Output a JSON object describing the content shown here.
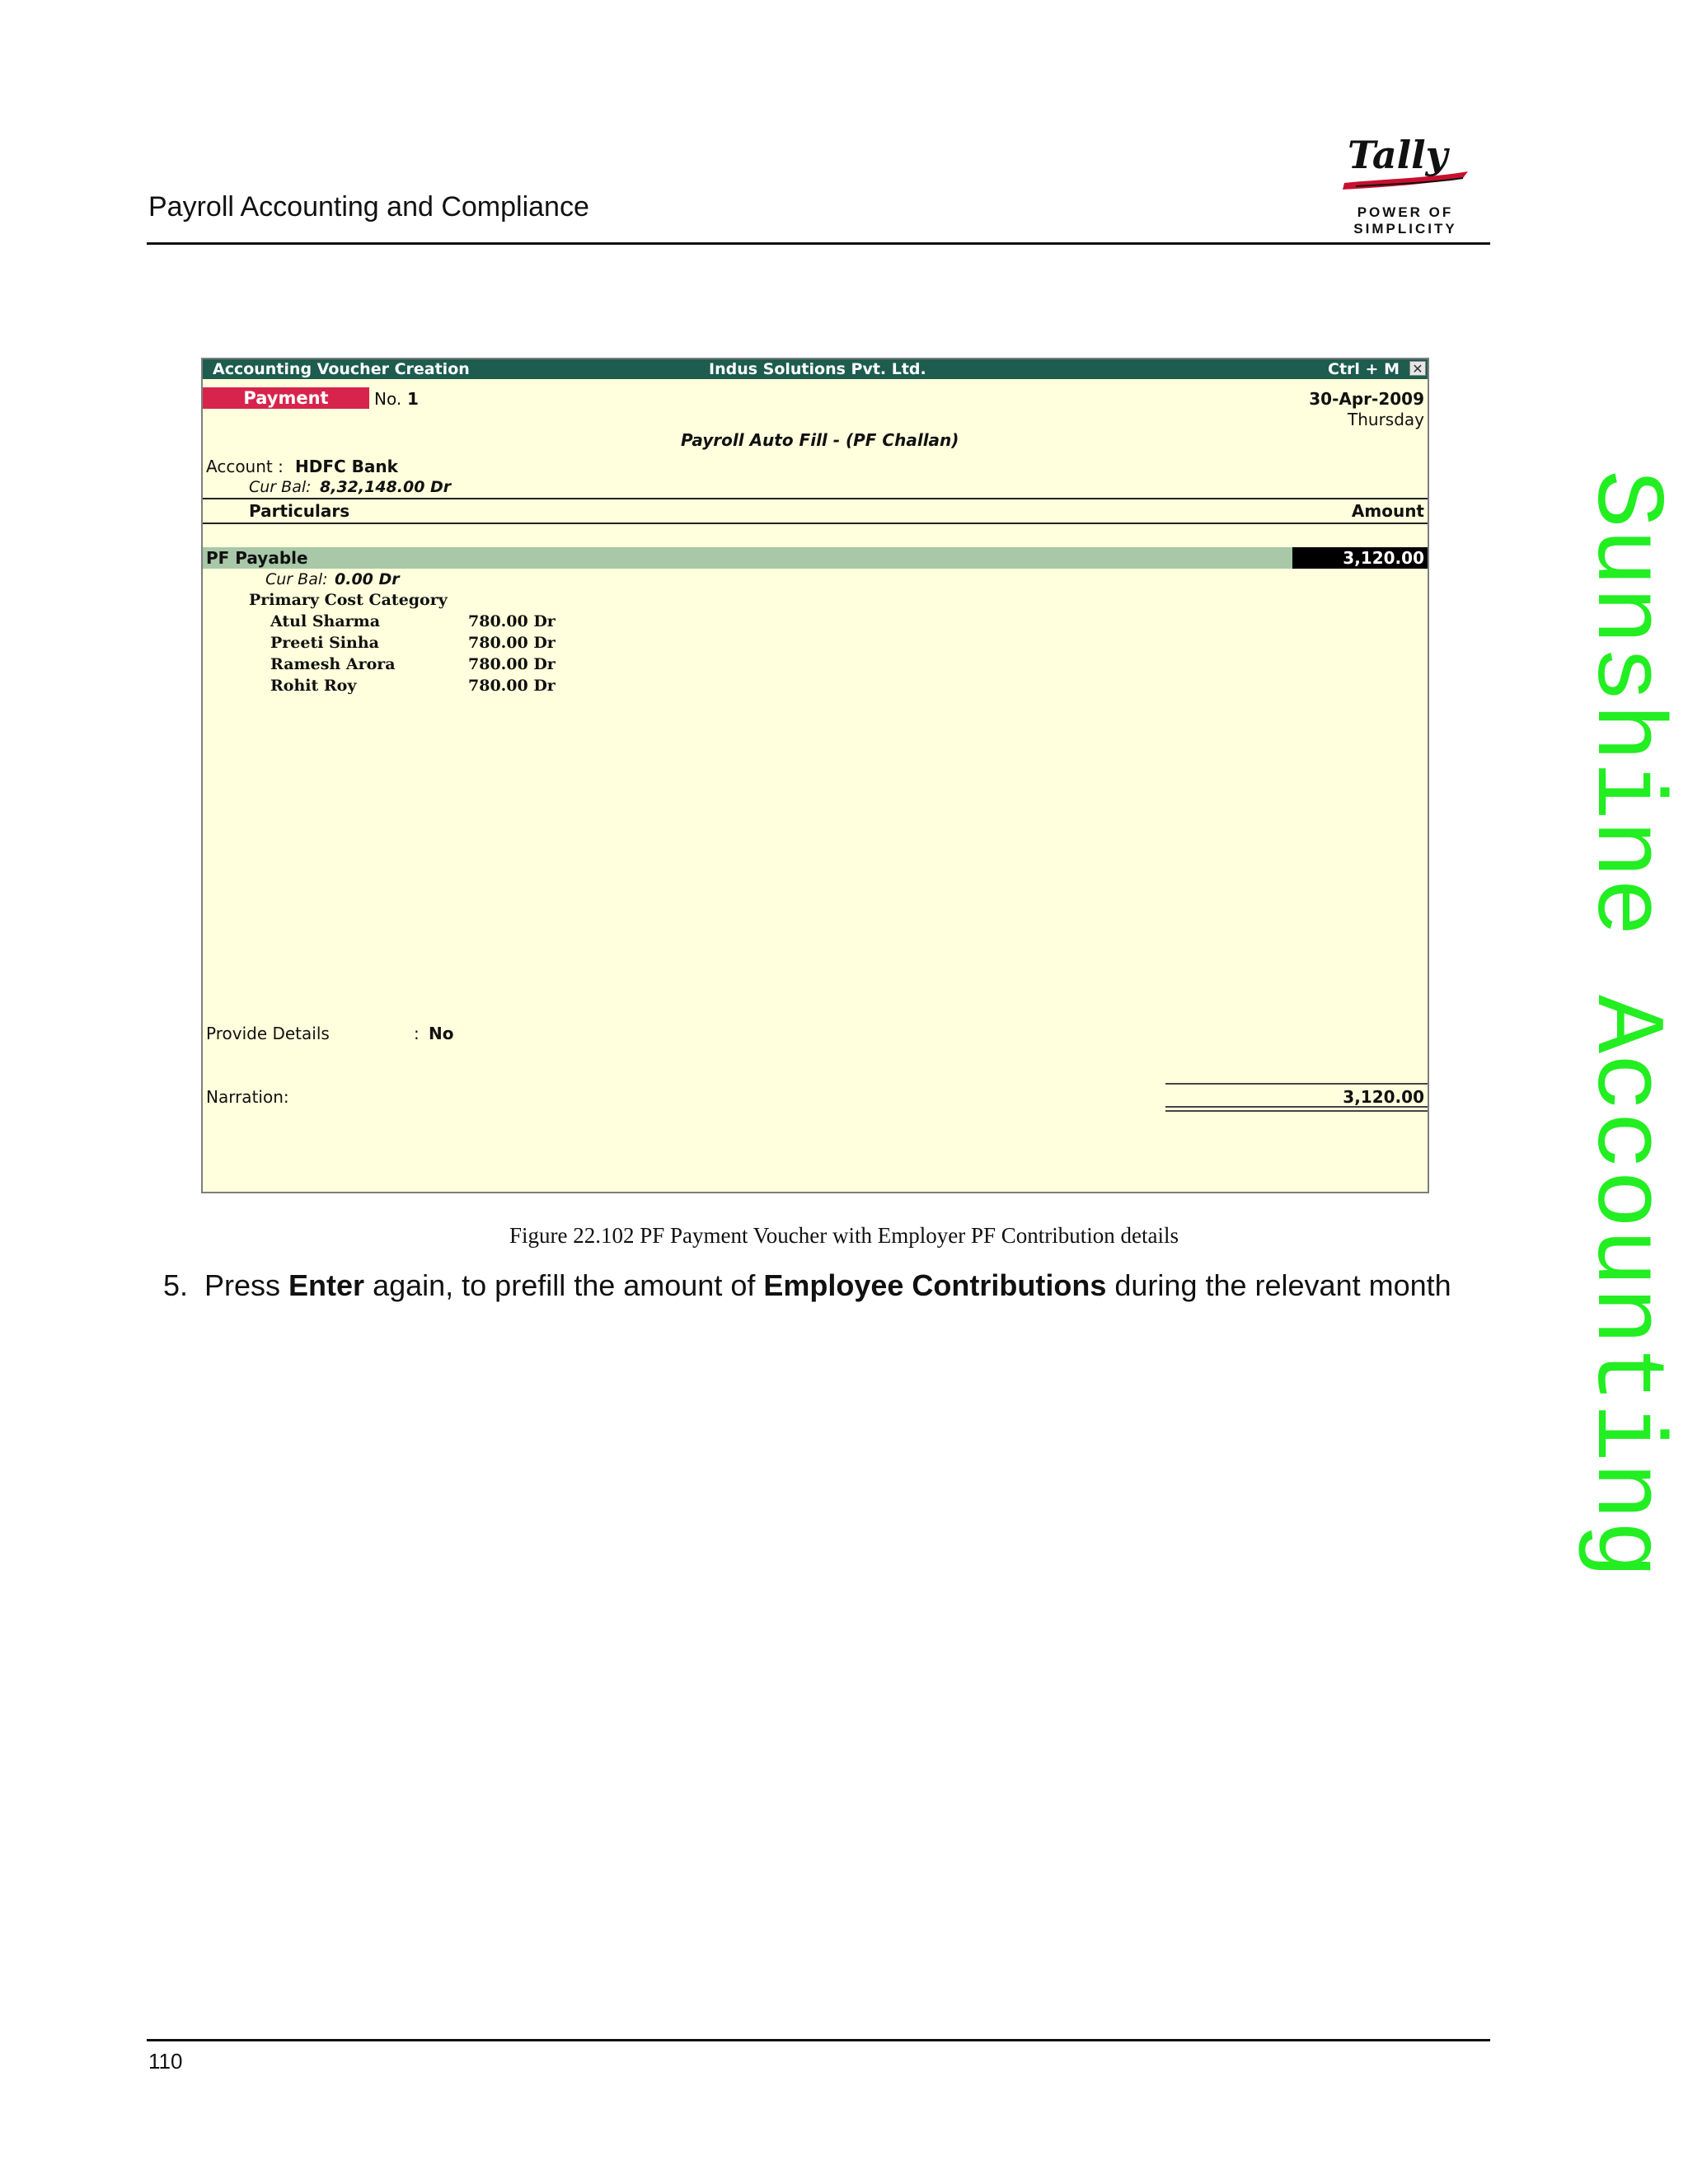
{
  "header": {
    "title": "Payroll Accounting and Compliance",
    "logo_word": "Tally",
    "logo_tagline": "POWER OF SIMPLICITY"
  },
  "watermark": "Sunshine Accounting",
  "screenshot": {
    "titlebar": {
      "left": "Accounting Voucher  Creation",
      "center": "Indus Solutions Pvt. Ltd.",
      "right": "Ctrl + M",
      "close_glyph": "✕"
    },
    "voucher_type": "Payment",
    "voucher_no_label": "No.",
    "voucher_no": "1",
    "date": "30-Apr-2009",
    "day": "Thursday",
    "mode": "Payroll Auto Fill - (PF Challan)",
    "account_label": "Account :",
    "account": "HDFC Bank",
    "cur_bal_label": "Cur Bal:",
    "cur_bal": "8,32,148.00 Dr",
    "col_particulars": "Particulars",
    "col_amount": "Amount",
    "ledger": {
      "name": "PF Payable",
      "amount": "3,120.00",
      "cur_bal_label": "Cur Bal:",
      "cur_bal": "0.00 Dr",
      "cost_category": "Primary Cost Category",
      "allocations": [
        {
          "name": "Atul Sharma",
          "amount": "780.00 Dr"
        },
        {
          "name": "Preeti Sinha",
          "amount": "780.00 Dr"
        },
        {
          "name": "Ramesh Arora",
          "amount": "780.00 Dr"
        },
        {
          "name": "Rohit Roy",
          "amount": "780.00 Dr"
        }
      ]
    },
    "provide_details_label": "Provide Details",
    "provide_details_sep": ":",
    "provide_details_value": "No",
    "narration_label": "Narration:",
    "total": "3,120.00"
  },
  "caption": "Figure 22.102  PF Payment Voucher with Employer PF Contribution details",
  "step": {
    "number": "5.",
    "t1": "Press ",
    "b1": "Enter",
    "t2": " again, to prefill the amount of ",
    "b2": "Employee Contributions",
    "t3": " during the relevant month"
  },
  "page_number": "110",
  "colors": {
    "titlebar": "#1d5c4e",
    "voucher_type": "#d7244d",
    "screen_bg": "#ffffdd",
    "selected_row": "#a8c8a8",
    "watermark": "#22ee22",
    "logo_red": "#c8102e"
  }
}
